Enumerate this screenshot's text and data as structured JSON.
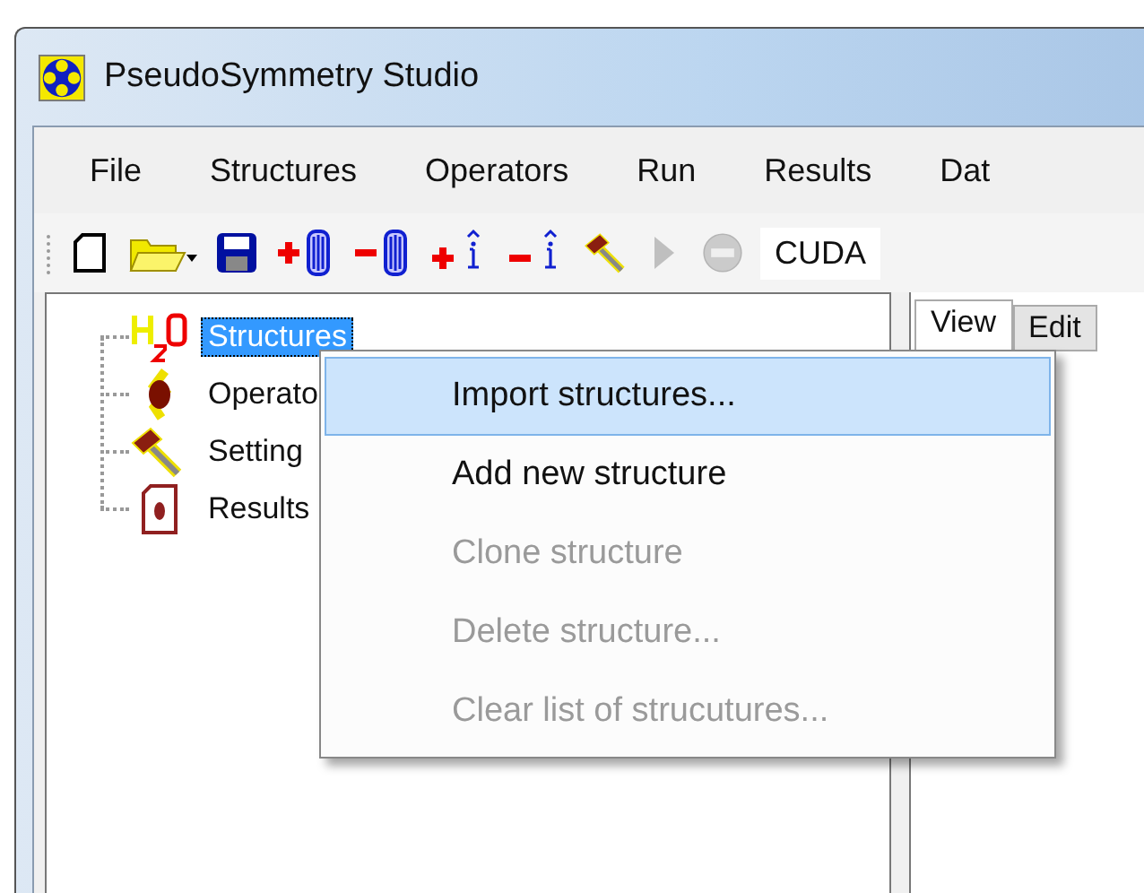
{
  "window": {
    "title": "PseudoSymmetry Studio"
  },
  "menu_bar": [
    "File",
    "Structures",
    "Operators",
    "Run",
    "Results",
    "Dat"
  ],
  "toolbar": {
    "tools": [
      {
        "kind": "new",
        "disabled": false
      },
      {
        "kind": "open",
        "disabled": false
      },
      {
        "kind": "save",
        "disabled": false
      },
      {
        "kind": "add-structure",
        "disabled": false
      },
      {
        "kind": "remove-structure",
        "disabled": false
      },
      {
        "kind": "add-operator",
        "disabled": false
      },
      {
        "kind": "remove-operator",
        "disabled": false
      },
      {
        "kind": "hammer",
        "disabled": false
      },
      {
        "kind": "run",
        "disabled": true
      },
      {
        "kind": "stop",
        "disabled": true
      }
    ],
    "device": "CUDA"
  },
  "tree": [
    {
      "label": "Structures",
      "kind": "water",
      "selected": true
    },
    {
      "label": "Operato",
      "kind": "operator",
      "selected": false
    },
    {
      "label": "Setting",
      "kind": "hammer",
      "selected": false
    },
    {
      "label": "Results",
      "kind": "document",
      "selected": false
    }
  ],
  "tabs": [
    {
      "label": "View",
      "selected": true
    },
    {
      "label": "Edit",
      "selected": false
    }
  ],
  "context_menu": [
    {
      "label": "Import structures...",
      "selected": true,
      "disabled": false
    },
    {
      "label": "Add new structure",
      "selected": false,
      "disabled": false
    },
    {
      "label": "Clone structure",
      "selected": false,
      "disabled": true
    },
    {
      "label": "Delete structure...",
      "selected": false,
      "disabled": true
    },
    {
      "label": "Clear list of strucutures...",
      "selected": false,
      "disabled": true
    }
  ]
}
